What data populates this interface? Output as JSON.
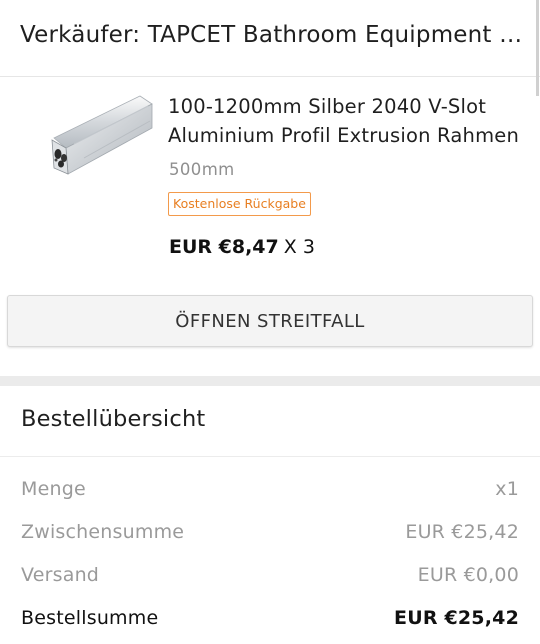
{
  "seller": {
    "text": "Verkäufer: TAPCET Bathroom Equipment Store"
  },
  "product": {
    "title_line1": "100-1200mm Silber 2040 V-Slot",
    "title_line2": "Aluminium Profil Extrusion Rahmen",
    "variant": "500mm",
    "badge": "Kostenlose Rückgabe",
    "price": "EUR €8,47",
    "quantity": "X 3",
    "image_icon": "aluminium-profile-image"
  },
  "actions": {
    "dispute_label": "ÖFFNEN STREITFALL"
  },
  "summary": {
    "title": "Bestellübersicht",
    "rows": [
      {
        "label": "Menge",
        "value": "x1"
      },
      {
        "label": "Zwischensumme",
        "value": "EUR €25,42"
      },
      {
        "label": "Versand",
        "value": "EUR €0,00"
      },
      {
        "label": "Bestellsumme",
        "value": "EUR €25,42"
      }
    ]
  },
  "colors": {
    "accent_orange": "#e87f22",
    "badge_border": "#f39a4b",
    "background": "#ebebeb"
  }
}
